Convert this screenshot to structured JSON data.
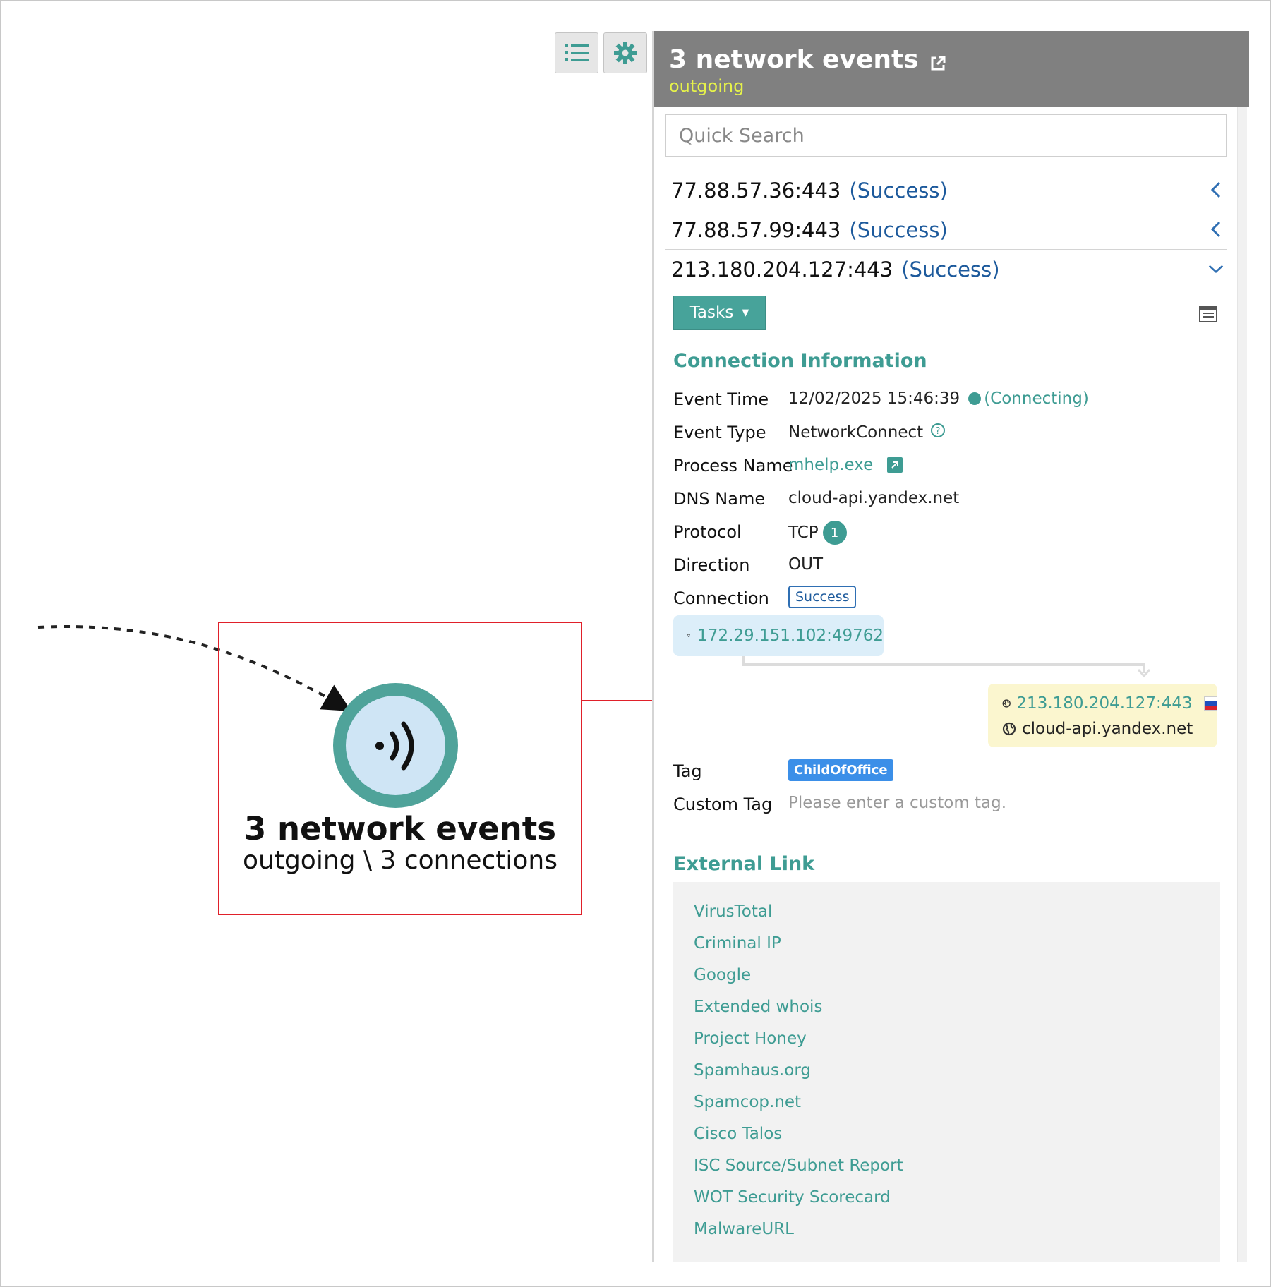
{
  "toolbar": {
    "list_icon": "list-icon",
    "settings_icon": "gear-icon"
  },
  "graph": {
    "node": {
      "icon": "network-signal-icon",
      "title": "3 network events",
      "subtitle": "outgoing \\ 3 connections"
    }
  },
  "panel": {
    "title": "3 network events",
    "subtitle": "outgoing",
    "search_placeholder": "Quick Search",
    "connections": [
      {
        "address": "77.88.57.36:443",
        "status": "(Success)",
        "expanded": false
      },
      {
        "address": "77.88.57.99:443",
        "status": "(Success)",
        "expanded": false
      },
      {
        "address": "213.180.204.127:443",
        "status": "(Success)",
        "expanded": true
      }
    ],
    "tasks_label": "Tasks",
    "connection_info": {
      "heading": "Connection Information",
      "event_time_label": "Event Time",
      "event_time": "12/02/2025 15:46:39",
      "event_state": "(Connecting)",
      "event_type_label": "Event Type",
      "event_type": "NetworkConnect",
      "process_name_label": "Process Name",
      "process_name": "mhelp.exe",
      "dns_name_label": "DNS Name",
      "dns_name": "cloud-api.yandex.net",
      "protocol_label": "Protocol",
      "protocol": "TCP",
      "protocol_count": "1",
      "direction_label": "Direction",
      "direction": "OUT",
      "connection_label": "Connection",
      "connection_status": "Success",
      "source": "172.29.151.102:49762",
      "target_ip": "213.180.204.127:443",
      "target_host": "cloud-api.yandex.net",
      "tag_label": "Tag",
      "tag": "ChildOfOffice",
      "custom_tag_label": "Custom Tag",
      "custom_tag_placeholder": "Please enter a custom tag."
    },
    "external": {
      "heading": "External Link",
      "links": [
        "VirusTotal",
        "Criminal IP",
        "Google",
        "Extended whois",
        "Project Honey",
        "Spamhaus.org",
        "Spamcop.net",
        "Cisco Talos",
        "ISC Source/Subnet Report",
        "WOT Security Scorecard",
        "MalwareURL"
      ]
    }
  },
  "colors": {
    "teal": "#3e9c93",
    "header_gray": "#808080",
    "highlight_red": "#e0202a",
    "status_blue": "#1d5a9c",
    "subtitle_yellow": "#e6f24a"
  }
}
